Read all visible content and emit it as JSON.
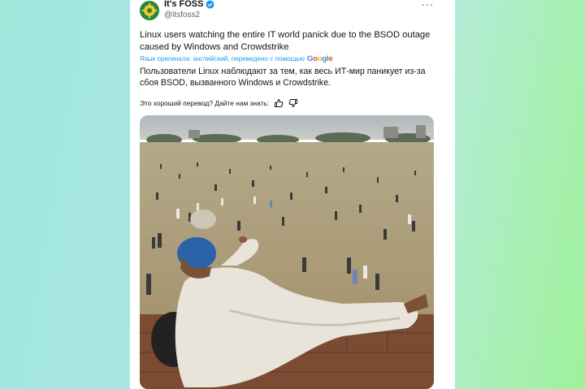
{
  "account": {
    "name": "It's FOSS",
    "handle": "@itsfoss2"
  },
  "tweet": {
    "text": "Linux users watching the entire IT world panick due to the BSOD outage caused by Windows and Crowdstrike",
    "translation_note": "Язык оригинала: английский, переведено с помощью",
    "translator": "Google",
    "translated_text": "Пользователи Linux наблюдают за тем, как весь ИТ-мир паникует из-за сбоя BSOD, вызванного Windows и Crowdstrike.",
    "rate_prompt": "Это хороший перевод? Дайте нам знать:"
  },
  "icons": {
    "verified": "verified-badge-icon",
    "more": "more-dots-icon",
    "thumbs_up": "thumbs-up-icon",
    "thumbs_down": "thumbs-down-icon"
  },
  "colors": {
    "link": "#1d9bf0",
    "text": "#0f1419",
    "muted": "#536471"
  }
}
